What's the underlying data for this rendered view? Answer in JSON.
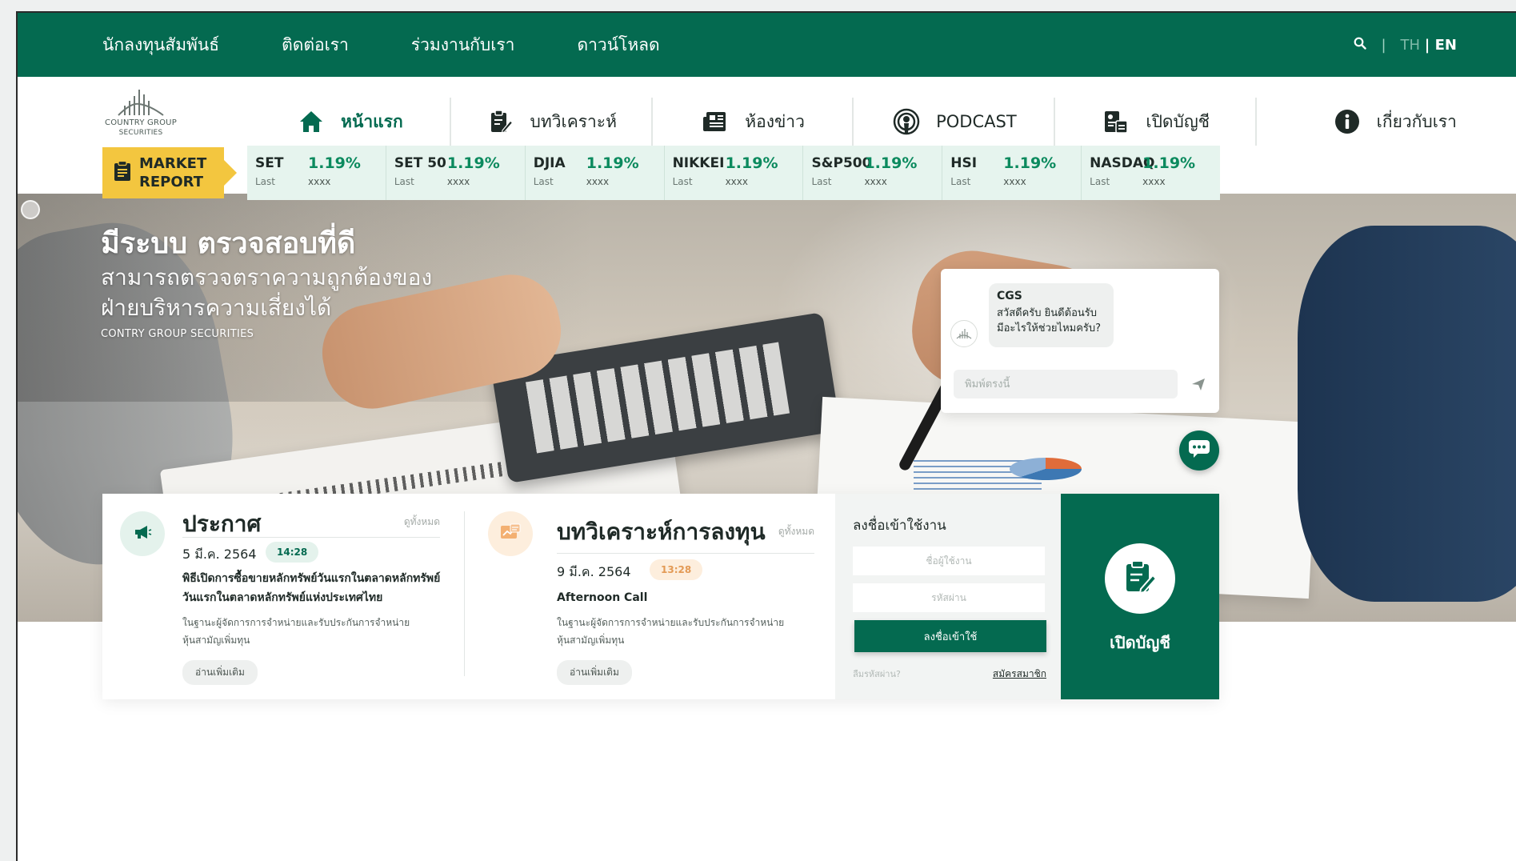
{
  "topbar": {
    "links": [
      "นักลงทุนสัมพันธ์",
      "ติดต่อเรา",
      "ร่วมงานกับเรา",
      "ดาวน์โหลด"
    ],
    "lang_sep": "|",
    "lang_th": "TH",
    "lang_en": "| EN"
  },
  "logo": {
    "line1": "COUNTRY GROUP",
    "line2": "SECURITIES"
  },
  "mainnav": [
    {
      "label": "หน้าแรก",
      "icon": "home-icon",
      "active": true
    },
    {
      "label": "บทวิเคราะห์",
      "icon": "clipboard-edit-icon",
      "active": false
    },
    {
      "label": "ห้องข่าว",
      "icon": "newspaper-icon",
      "active": false
    },
    {
      "label": "PODCAST",
      "icon": "podcast-icon",
      "active": false
    },
    {
      "label": "เปิดบัญชี",
      "icon": "open-account-icon",
      "active": false
    },
    {
      "label": "เกี่ยวกับเรา",
      "icon": "info-icon",
      "active": false
    }
  ],
  "market": {
    "badge_line1": "MARKET",
    "badge_line2": "REPORT",
    "tickers": [
      {
        "name": "SET",
        "pct": "1.19%",
        "last": "Last",
        "value": "xxxx"
      },
      {
        "name": "SET 50",
        "pct": "1.19%",
        "last": "Last",
        "value": "xxxx"
      },
      {
        "name": "DJIA",
        "pct": "1.19%",
        "last": "Last",
        "value": "xxxx"
      },
      {
        "name": "NIKKEI",
        "pct": "1.19%",
        "last": "Last",
        "value": "xxxx"
      },
      {
        "name": "S&P500",
        "pct": "1.19%",
        "last": "Last",
        "value": "xxxx"
      },
      {
        "name": "HSI",
        "pct": "1.19%",
        "last": "Last",
        "value": "xxxx"
      },
      {
        "name": "NASDAQ",
        "pct": "1.19%",
        "last": "Last",
        "value": "xxxx"
      }
    ]
  },
  "hero": {
    "headline": "มีระบบ ตรวจสอบที่ดี",
    "line2": "สามารถตรวจตราความถูกต้องของ",
    "line3": "ฝ่ายบริหารความเสี่ยงได้",
    "caption": "CONTRY GROUP SECURITIES"
  },
  "chat": {
    "sender": "CGS",
    "message": "สวัสดีครับ ยินดีต้อนรับ มีอะไรให้ช่วยไหมครับ?",
    "placeholder": "พิมพ์ตรงนี้"
  },
  "announcement": {
    "title": "ประกาศ",
    "see_all": "ดูทั้งหมด",
    "date": "5 มี.ค. 2564",
    "time": "14:28",
    "headline": "พิธีเปิดการซื้อขายหลักทรัพย์วันแรกในตลาดหลักทรัพย์วันแรกในตลาดหลักทรัพย์แห่งประเทศไทย",
    "desc": "ในฐานะผู้จัดการการจำหน่ายและรับประกันการจำหน่ายหุ้นสามัญเพิ่มทุน",
    "read_more": "อ่านเพิ่มเติม"
  },
  "analysis": {
    "title": "บทวิเคราะห์การลงทุน",
    "see_all": "ดูทั้งหมด",
    "date": "9 มี.ค. 2564",
    "time": "13:28",
    "headline": "Afternoon Call",
    "desc": "ในฐานะผู้จัดการการจำหน่ายและรับประกันการจำหน่ายหุ้นสามัญเพิ่มทุน",
    "read_more": "อ่านเพิ่มเติม"
  },
  "login": {
    "title": "ลงชื่อเข้าใช้งาน",
    "username_placeholder": "ชื่อผู้ใช้งาน",
    "password_placeholder": "รหัสผ่าน",
    "submit": "ลงชื่อเข้าใช้",
    "forgot": "ลืมรหัสผ่าน?",
    "register": "สมัครสมาชิก"
  },
  "open_account": {
    "label": "เปิดบัญชี"
  },
  "colors": {
    "brand_green": "#046a50",
    "badge_yellow": "#f3c63f",
    "ticker_bg": "#e6f4ee",
    "up_green": "#0b8a5e"
  }
}
